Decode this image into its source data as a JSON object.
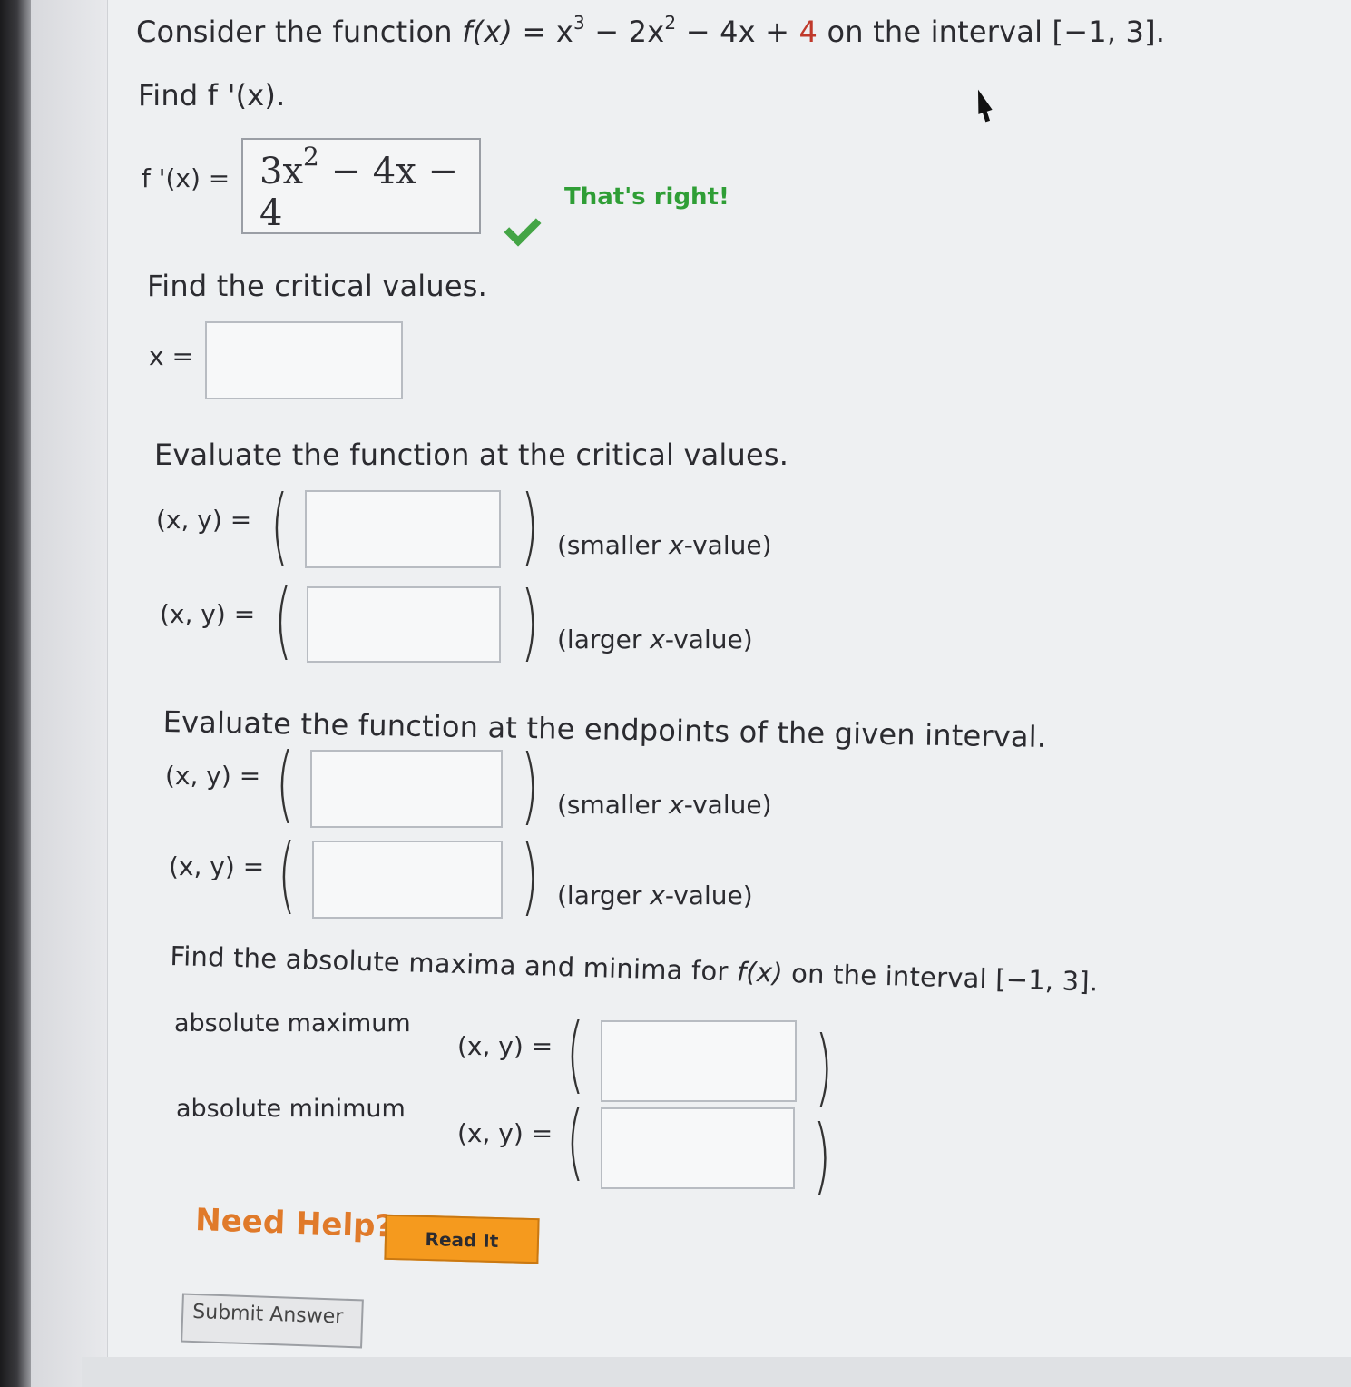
{
  "question": {
    "intro": "Consider the function",
    "f_lhs": "f(x)",
    "f_eq": "= x",
    "exp3": "3",
    "part2": "− 2x",
    "exp2": "2",
    "part3": "− 4x +",
    "const": "4",
    "interval_text": "on the interval [−1, 3]."
  },
  "derivative": {
    "prompt": "Find f '(x).",
    "label": "f '(x) =",
    "answer_coeff": "3x",
    "answer_exp": "2",
    "answer_rest": "− 4x − 4",
    "feedback": "That's right!",
    "status_icon": "check-icon"
  },
  "critical": {
    "prompt": "Find the critical values.",
    "label": "x ="
  },
  "eval_critical": {
    "prompt": "Evaluate the function at the critical values.",
    "row1_label": "(x, y) =",
    "row1_note_pre": "(smaller ",
    "row1_note_x": "x",
    "row1_note_post": "-value)",
    "row2_label": "(x, y) =",
    "row2_note_pre": "(larger ",
    "row2_note_x": "x",
    "row2_note_post": "-value)"
  },
  "eval_endpoints": {
    "prompt": "Evaluate the function at the endpoints of the given interval.",
    "row1_label": "(x, y) =",
    "row1_note_pre": "(smaller ",
    "row1_note_x": "x",
    "row1_note_post": "-value)",
    "row2_label": "(x, y) =",
    "row2_note_pre": "(larger ",
    "row2_note_x": "x",
    "row2_note_post": "-value)"
  },
  "extrema": {
    "prompt_pre": "Find the absolute maxima and minima for",
    "prompt_f": "f(x)",
    "prompt_post": "on the interval [−1, 3].",
    "max_label": "absolute maximum",
    "max_xy": "(x, y) =",
    "min_label": "absolute minimum",
    "min_xy": "(x, y) ="
  },
  "help": {
    "label": "Need Help?",
    "read_it": "Read It"
  },
  "submit": {
    "label": "Submit Answer"
  },
  "colors": {
    "accent_orange": "#e07a2a",
    "button_orange": "#f59a1e",
    "success_green": "#2f9e36",
    "constant_red": "#c0392b"
  }
}
